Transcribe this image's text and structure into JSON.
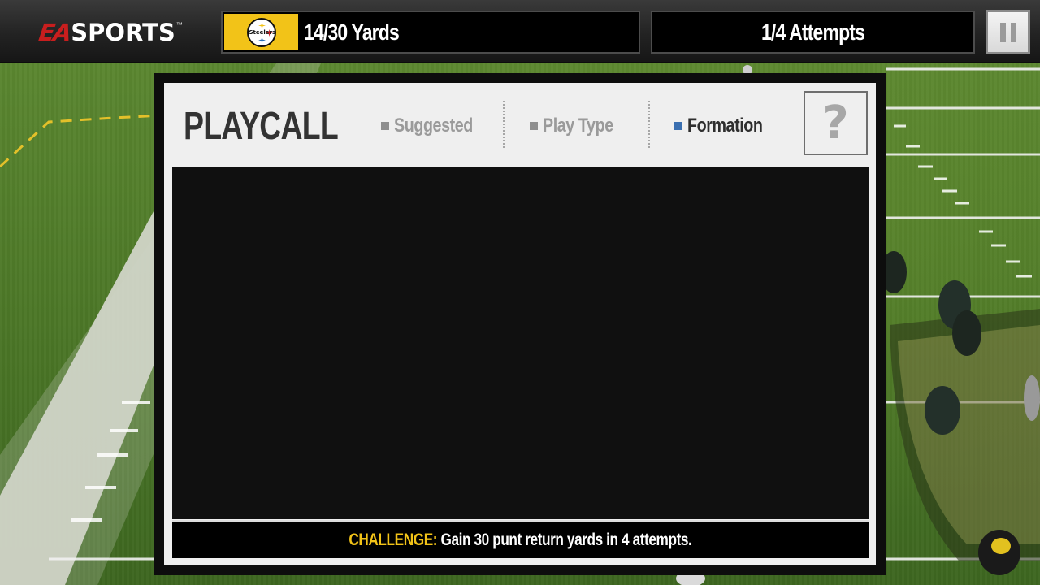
{
  "header": {
    "logo": {
      "ea": "EA",
      "sports": "SPORTS",
      "tm": "™"
    },
    "team_logo": {
      "wordmark": "Steelers"
    },
    "yards": "14/30 Yards",
    "attempts": "1/4 Attempts"
  },
  "panel": {
    "title": "PLAYCALL",
    "tabs": [
      {
        "label": "Suggested",
        "active": false
      },
      {
        "label": "Play Type",
        "active": false
      },
      {
        "label": "Formation",
        "active": true
      }
    ],
    "help_label": "?",
    "challenge": {
      "label": "CHALLENGE:",
      "text": " Gain 30 punt return yards in 4 attempts."
    }
  },
  "colors": {
    "team_yellow": "#f2c318",
    "active_tab": "#3a6fb0",
    "field_green": "#4f7a2a"
  },
  "icons": [
    "pause-icon",
    "help-icon",
    "steelers-logo"
  ]
}
